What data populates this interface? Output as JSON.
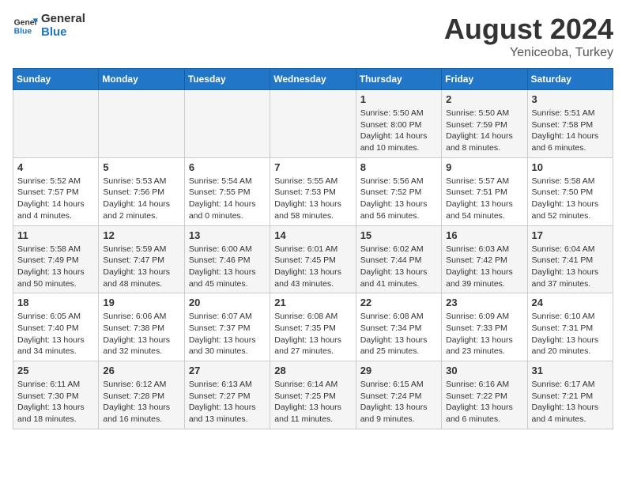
{
  "header": {
    "logo": {
      "text_general": "General",
      "text_blue": "Blue"
    },
    "title": "August 2024",
    "location": "Yeniceoba, Turkey"
  },
  "weekdays": [
    "Sunday",
    "Monday",
    "Tuesday",
    "Wednesday",
    "Thursday",
    "Friday",
    "Saturday"
  ],
  "weeks": [
    [
      {
        "day": "",
        "info": ""
      },
      {
        "day": "",
        "info": ""
      },
      {
        "day": "",
        "info": ""
      },
      {
        "day": "",
        "info": ""
      },
      {
        "day": "1",
        "info": "Sunrise: 5:50 AM\nSunset: 8:00 PM\nDaylight: 14 hours and 10 minutes."
      },
      {
        "day": "2",
        "info": "Sunrise: 5:50 AM\nSunset: 7:59 PM\nDaylight: 14 hours and 8 minutes."
      },
      {
        "day": "3",
        "info": "Sunrise: 5:51 AM\nSunset: 7:58 PM\nDaylight: 14 hours and 6 minutes."
      }
    ],
    [
      {
        "day": "4",
        "info": "Sunrise: 5:52 AM\nSunset: 7:57 PM\nDaylight: 14 hours and 4 minutes."
      },
      {
        "day": "5",
        "info": "Sunrise: 5:53 AM\nSunset: 7:56 PM\nDaylight: 14 hours and 2 minutes."
      },
      {
        "day": "6",
        "info": "Sunrise: 5:54 AM\nSunset: 7:55 PM\nDaylight: 14 hours and 0 minutes."
      },
      {
        "day": "7",
        "info": "Sunrise: 5:55 AM\nSunset: 7:53 PM\nDaylight: 13 hours and 58 minutes."
      },
      {
        "day": "8",
        "info": "Sunrise: 5:56 AM\nSunset: 7:52 PM\nDaylight: 13 hours and 56 minutes."
      },
      {
        "day": "9",
        "info": "Sunrise: 5:57 AM\nSunset: 7:51 PM\nDaylight: 13 hours and 54 minutes."
      },
      {
        "day": "10",
        "info": "Sunrise: 5:58 AM\nSunset: 7:50 PM\nDaylight: 13 hours and 52 minutes."
      }
    ],
    [
      {
        "day": "11",
        "info": "Sunrise: 5:58 AM\nSunset: 7:49 PM\nDaylight: 13 hours and 50 minutes."
      },
      {
        "day": "12",
        "info": "Sunrise: 5:59 AM\nSunset: 7:47 PM\nDaylight: 13 hours and 48 minutes."
      },
      {
        "day": "13",
        "info": "Sunrise: 6:00 AM\nSunset: 7:46 PM\nDaylight: 13 hours and 45 minutes."
      },
      {
        "day": "14",
        "info": "Sunrise: 6:01 AM\nSunset: 7:45 PM\nDaylight: 13 hours and 43 minutes."
      },
      {
        "day": "15",
        "info": "Sunrise: 6:02 AM\nSunset: 7:44 PM\nDaylight: 13 hours and 41 minutes."
      },
      {
        "day": "16",
        "info": "Sunrise: 6:03 AM\nSunset: 7:42 PM\nDaylight: 13 hours and 39 minutes."
      },
      {
        "day": "17",
        "info": "Sunrise: 6:04 AM\nSunset: 7:41 PM\nDaylight: 13 hours and 37 minutes."
      }
    ],
    [
      {
        "day": "18",
        "info": "Sunrise: 6:05 AM\nSunset: 7:40 PM\nDaylight: 13 hours and 34 minutes."
      },
      {
        "day": "19",
        "info": "Sunrise: 6:06 AM\nSunset: 7:38 PM\nDaylight: 13 hours and 32 minutes."
      },
      {
        "day": "20",
        "info": "Sunrise: 6:07 AM\nSunset: 7:37 PM\nDaylight: 13 hours and 30 minutes."
      },
      {
        "day": "21",
        "info": "Sunrise: 6:08 AM\nSunset: 7:35 PM\nDaylight: 13 hours and 27 minutes."
      },
      {
        "day": "22",
        "info": "Sunrise: 6:08 AM\nSunset: 7:34 PM\nDaylight: 13 hours and 25 minutes."
      },
      {
        "day": "23",
        "info": "Sunrise: 6:09 AM\nSunset: 7:33 PM\nDaylight: 13 hours and 23 minutes."
      },
      {
        "day": "24",
        "info": "Sunrise: 6:10 AM\nSunset: 7:31 PM\nDaylight: 13 hours and 20 minutes."
      }
    ],
    [
      {
        "day": "25",
        "info": "Sunrise: 6:11 AM\nSunset: 7:30 PM\nDaylight: 13 hours and 18 minutes."
      },
      {
        "day": "26",
        "info": "Sunrise: 6:12 AM\nSunset: 7:28 PM\nDaylight: 13 hours and 16 minutes."
      },
      {
        "day": "27",
        "info": "Sunrise: 6:13 AM\nSunset: 7:27 PM\nDaylight: 13 hours and 13 minutes."
      },
      {
        "day": "28",
        "info": "Sunrise: 6:14 AM\nSunset: 7:25 PM\nDaylight: 13 hours and 11 minutes."
      },
      {
        "day": "29",
        "info": "Sunrise: 6:15 AM\nSunset: 7:24 PM\nDaylight: 13 hours and 9 minutes."
      },
      {
        "day": "30",
        "info": "Sunrise: 6:16 AM\nSunset: 7:22 PM\nDaylight: 13 hours and 6 minutes."
      },
      {
        "day": "31",
        "info": "Sunrise: 6:17 AM\nSunset: 7:21 PM\nDaylight: 13 hours and 4 minutes."
      }
    ]
  ]
}
